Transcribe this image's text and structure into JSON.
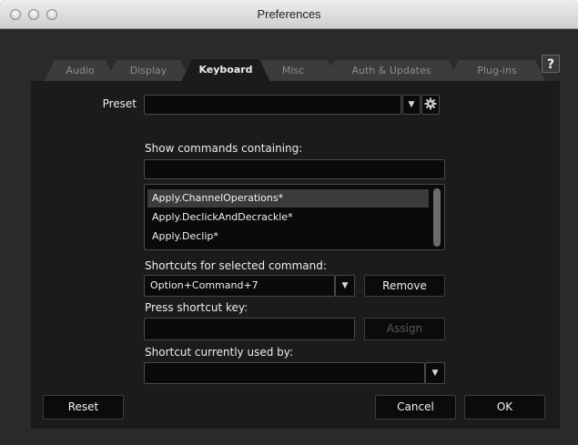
{
  "window": {
    "title": "Preferences"
  },
  "tabs": [
    {
      "label": "Audio"
    },
    {
      "label": "Display"
    },
    {
      "label": "Keyboard",
      "active": true
    },
    {
      "label": "Misc"
    },
    {
      "label": "Auth & Updates"
    },
    {
      "label": "Plug-ins"
    }
  ],
  "help": {
    "label": "?"
  },
  "preset": {
    "label": "Preset",
    "value": "",
    "dropdown_glyph": "▼"
  },
  "filter": {
    "label": "Show commands containing:",
    "value": ""
  },
  "commands": {
    "items": [
      "Apply.ChannelOperations*",
      "Apply.DeclickAndDecrackle*",
      "Apply.Declip*"
    ],
    "selected_index": 0
  },
  "shortcuts": {
    "label": "Shortcuts for selected command:",
    "value": "Option+Command+7",
    "dropdown_glyph": "▼",
    "remove_label": "Remove"
  },
  "press_key": {
    "label": "Press shortcut key:",
    "value": "",
    "assign_label": "Assign"
  },
  "used_by": {
    "label": "Shortcut currently used by:",
    "value": "",
    "dropdown_glyph": "▼"
  },
  "footer": {
    "reset_label": "Reset",
    "cancel_label": "Cancel",
    "ok_label": "OK"
  },
  "colors": {
    "background": "#2a2a2a",
    "panel": "#1b1b1b",
    "field": "#0a0a0a",
    "selection": "#3b3b3b"
  },
  "icons": [
    "gear-icon",
    "chevron-down-icon",
    "help-icon",
    "scrollbar-thumb"
  ]
}
